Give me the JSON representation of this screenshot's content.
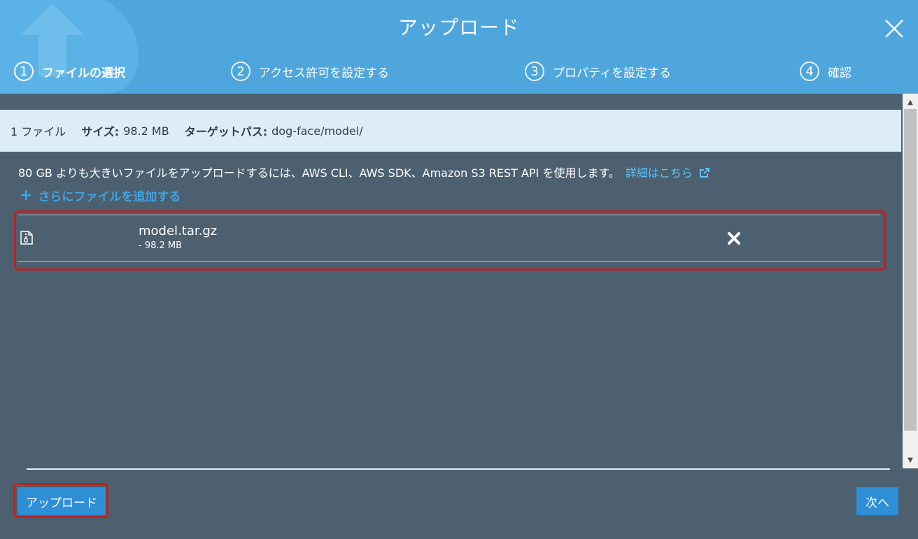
{
  "dialog": {
    "title": "アップロード",
    "close_icon": "close-icon"
  },
  "steps": [
    {
      "num": "1",
      "label": "ファイルの選択",
      "active": true
    },
    {
      "num": "2",
      "label": "アクセス許可を設定する",
      "active": false
    },
    {
      "num": "3",
      "label": "プロパティを設定する",
      "active": false
    },
    {
      "num": "4",
      "label": "確認",
      "active": false
    }
  ],
  "summary": {
    "file_count": "1 ファイル",
    "size_label": "サイズ:",
    "size_value": "98.2 MB",
    "target_label": "ターゲットパス:",
    "target_value": "dog-face/model/"
  },
  "info": {
    "text": "80 GB よりも大きいファイルをアップロードするには、AWS CLI、AWS SDK、Amazon S3 REST API を使用します。",
    "link": "詳細はこちら"
  },
  "add_more": {
    "label": "さらにファイルを追加する"
  },
  "files": [
    {
      "name": "model.tar.gz",
      "size": "- 98.2 MB"
    }
  ],
  "footer": {
    "upload_label": "アップロード",
    "next_label": "次へ"
  },
  "colors": {
    "header": "#4ea6dd",
    "body": "#4c6070",
    "accent": "#2e8ed6",
    "highlight": "#c0221e"
  }
}
